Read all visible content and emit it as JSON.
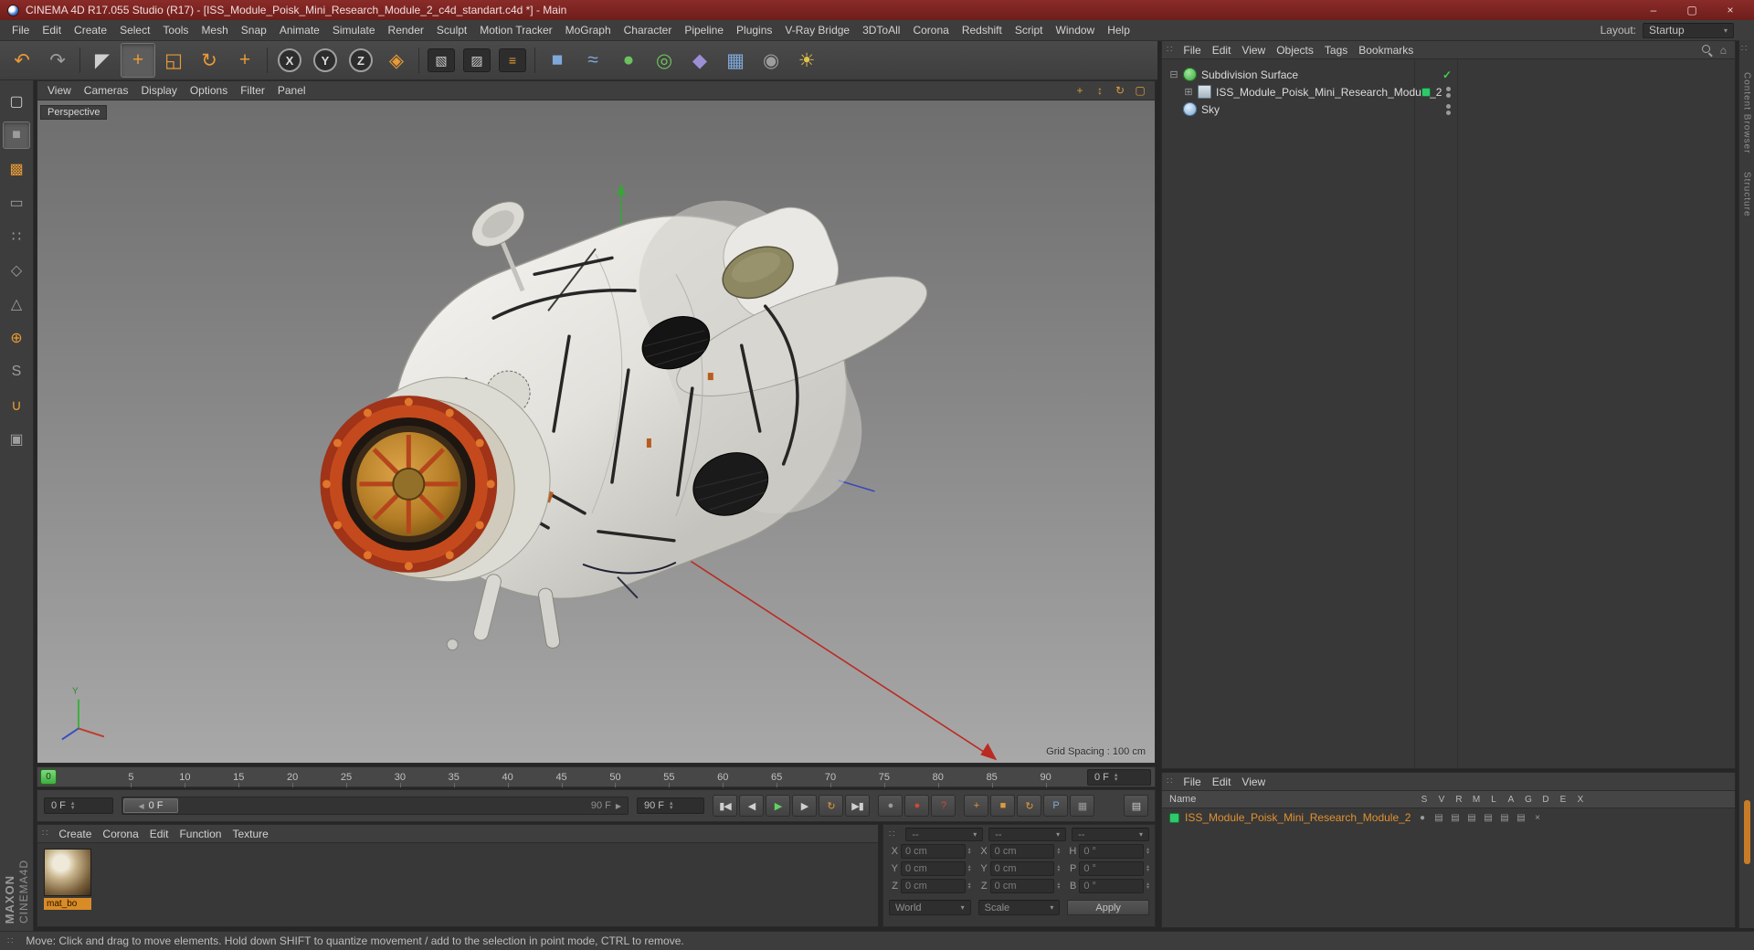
{
  "glyphs": {
    "grip": "∷",
    "caret": "▾",
    "spin_up": "▴",
    "spin_down": "▾",
    "home": "⌂"
  },
  "titlebar": {
    "title": "CINEMA 4D R17.055 Studio (R17) - [ISS_Module_Poisk_Mini_Research_Module_2_c4d_standart.c4d *] - Main",
    "minimize_glyph": "–",
    "maximize_glyph": "▢",
    "close_glyph": "×"
  },
  "menubar": {
    "items": [
      "File",
      "Edit",
      "Create",
      "Select",
      "Tools",
      "Mesh",
      "Snap",
      "Animate",
      "Simulate",
      "Render",
      "Sculpt",
      "Motion Tracker",
      "MoGraph",
      "Character",
      "Pipeline",
      "Plugins",
      "V-Ray Bridge",
      "3DToAll",
      "Corona",
      "Redshift",
      "Script",
      "Window",
      "Help"
    ],
    "layout_label": "Layout:",
    "layout_value": "Startup"
  },
  "toolbar": {
    "tools": [
      {
        "name": "undo-icon",
        "glyph": "↶",
        "color": "orange"
      },
      {
        "name": "redo-icon",
        "glyph": "↷",
        "color": "gray"
      },
      {
        "name": "toolbar-separator",
        "type": "sep",
        "glyph": "",
        "interactable": "false"
      },
      {
        "name": "live-selection-tool",
        "glyph": "◤",
        "color": "light"
      },
      {
        "name": "move-tool",
        "glyph": "+",
        "color": "orange",
        "state": "active"
      },
      {
        "name": "scale-tool",
        "glyph": "◱",
        "color": "orange"
      },
      {
        "name": "rotate-tool",
        "glyph": "↻",
        "color": "orange"
      },
      {
        "name": "last-used-tool",
        "glyph": "+",
        "color": "orange"
      },
      {
        "name": "toolbar-separator",
        "type": "sep",
        "glyph": "",
        "interactable": "false"
      },
      {
        "name": "lock-x-axis-button",
        "glyph": "X",
        "shape": "circle"
      },
      {
        "name": "lock-y-axis-button",
        "glyph": "Y",
        "shape": "circle"
      },
      {
        "name": "lock-z-axis-button",
        "glyph": "Z",
        "shape": "circle"
      },
      {
        "name": "coordinate-system-button",
        "glyph": "◈",
        "color": "orange"
      },
      {
        "name": "toolbar-separator",
        "type": "sep",
        "glyph": "",
        "interactable": "false"
      },
      {
        "name": "render-view-button",
        "glyph": "▧",
        "shape": "tile",
        "color": "light"
      },
      {
        "name": "render-to-picture-viewer-button",
        "glyph": "▨",
        "shape": "tile",
        "color": "light"
      },
      {
        "name": "render-settings-button",
        "glyph": "≡",
        "shape": "tile",
        "color": "orange"
      },
      {
        "name": "toolbar-separator",
        "type": "sep",
        "glyph": "",
        "interactable": "false"
      },
      {
        "name": "add-primitive-button",
        "glyph": "■",
        "color": "blue"
      },
      {
        "name": "add-spline-button",
        "glyph": "≈",
        "color": "blue"
      },
      {
        "name": "add-generator-button",
        "glyph": "●",
        "color": "green"
      },
      {
        "name": "add-mograph-button",
        "glyph": "◎",
        "color": "green"
      },
      {
        "name": "add-deformer-button",
        "glyph": "◆",
        "color": "purple"
      },
      {
        "name": "add-environment-button",
        "glyph": "▦",
        "color": "blue"
      },
      {
        "name": "add-camera-button",
        "glyph": "◉",
        "color": "gray"
      },
      {
        "name": "add-light-button",
        "glyph": "☀",
        "color": "yellow"
      }
    ]
  },
  "left_toolbar": {
    "tools": [
      {
        "name": "make-editable-button",
        "glyph": "▢",
        "color": "light"
      },
      {
        "name": "model-mode-button",
        "glyph": "■",
        "color": "gray",
        "state": "active"
      },
      {
        "name": "texture-mode-button",
        "glyph": "▩",
        "color": "orange"
      },
      {
        "name": "workplane-mode-button",
        "glyph": "▭",
        "color": "gray"
      },
      {
        "name": "points-mode-button",
        "glyph": "∷",
        "color": "gray"
      },
      {
        "name": "edges-mode-button",
        "glyph": "◇",
        "color": "gray"
      },
      {
        "name": "polygons-mode-button",
        "glyph": "△",
        "color": "gray"
      },
      {
        "name": "enable-axis-button",
        "glyph": "⊕",
        "color": "orange"
      },
      {
        "name": "viewport-solo-button",
        "glyph": "S",
        "color": "gray"
      },
      {
        "name": "snap-button",
        "glyph": "∪",
        "color": "orange"
      },
      {
        "name": "lock-workplane-button",
        "glyph": "▣",
        "color": "gray"
      }
    ]
  },
  "viewport": {
    "menu": [
      "View",
      "Cameras",
      "Display",
      "Options",
      "Filter",
      "Panel"
    ],
    "nav_icons": [
      {
        "name": "pan-view-icon",
        "glyph": "+"
      },
      {
        "name": "dolly-view-icon",
        "glyph": "↕"
      },
      {
        "name": "rotate-view-icon",
        "glyph": "↻"
      },
      {
        "name": "toggle-active-view-icon",
        "glyph": "▢"
      }
    ],
    "camera_label": "Perspective",
    "grid_spacing": "Grid Spacing : 100 cm",
    "axis_y_label": "Y"
  },
  "timeline": {
    "marker": "0",
    "ticks": [
      "5",
      "10",
      "15",
      "20",
      "25",
      "30",
      "35",
      "40",
      "45",
      "50",
      "55",
      "60",
      "65",
      "70",
      "75",
      "80",
      "85",
      "90"
    ],
    "frame_spinner": "0 F"
  },
  "playbar": {
    "start_field": "0 F",
    "slider_handle": "0 F",
    "slider_end": "90 F",
    "end_field": "90 F",
    "handle_grip": "◀",
    "end_grip": "▶",
    "transport": [
      {
        "name": "go-to-start-button",
        "glyph": "▮◀"
      },
      {
        "name": "previous-frame-button",
        "glyph": "◀"
      },
      {
        "name": "play-button",
        "glyph": "▶",
        "color": "green"
      },
      {
        "name": "next-frame-button",
        "glyph": "▶"
      },
      {
        "name": "loop-mode-button",
        "glyph": "↻",
        "color": "orange"
      },
      {
        "name": "go-to-end-button",
        "glyph": "▶▮"
      }
    ],
    "record": [
      {
        "name": "record-scene-button",
        "glyph": "●",
        "color": "gray"
      },
      {
        "name": "record-keyframe-button",
        "glyph": "●",
        "color": "red"
      },
      {
        "name": "autokey-button",
        "glyph": "?",
        "color": "red"
      }
    ],
    "keyframe": [
      {
        "name": "key-position-button",
        "glyph": "+",
        "color": "orange"
      },
      {
        "name": "key-scale-button",
        "glyph": "■",
        "color": "orange"
      },
      {
        "name": "key-rotation-button",
        "glyph": "↻",
        "color": "orange"
      },
      {
        "name": "key-parameter-button",
        "glyph": "P",
        "color": "blue"
      },
      {
        "name": "key-selection-button",
        "glyph": "▦",
        "color": "gray"
      }
    ],
    "options_glyph": "▤"
  },
  "materials": {
    "menu": [
      "Create",
      "Corona",
      "Edit",
      "Function",
      "Texture"
    ],
    "material_name": "mat_bo"
  },
  "coordinates": {
    "headers": [
      "--",
      "--",
      "--"
    ],
    "rows": [
      {
        "l1": "X",
        "v1": "0 cm",
        "l2": "X",
        "v2": "0 cm",
        "l3": "H",
        "v3": "0 °"
      },
      {
        "l1": "Y",
        "v1": "0 cm",
        "l2": "Y",
        "v2": "0 cm",
        "l3": "P",
        "v3": "0 °"
      },
      {
        "l1": "Z",
        "v1": "0 cm",
        "l2": "Z",
        "v2": "0 cm",
        "l3": "B",
        "v3": "0 °"
      }
    ],
    "space_value": "World",
    "scale_value": "Scale",
    "apply_label": "Apply"
  },
  "object_manager": {
    "menu": [
      "File",
      "Edit",
      "View",
      "Objects",
      "Tags",
      "Bookmarks"
    ],
    "objects": [
      {
        "name": "Subdivision Surface",
        "icon": "subdivision-surface",
        "depth": "0",
        "expander": "⊟",
        "chip_style": "visibility:hidden",
        "col2": "check",
        "check": "✓"
      },
      {
        "name": "ISS_Module_Poisk_Mini_Research_Module_2",
        "icon": "polygon-object",
        "depth": "1",
        "expander": "⊞",
        "chip_style": "background:#2ec96a",
        "col2": "dots",
        "check": ""
      },
      {
        "name": "Sky",
        "icon": "sky-object",
        "depth": "0",
        "expander": "",
        "chip_style": "visibility:hidden",
        "col2": "dots",
        "check": ""
      }
    ]
  },
  "layer_panel": {
    "menu": [
      "File",
      "Edit",
      "View"
    ],
    "name_header": "Name",
    "columns": [
      "S",
      "V",
      "R",
      "M",
      "L",
      "A",
      "G",
      "D",
      "E",
      "X"
    ],
    "item": {
      "name": "ISS_Module_Poisk_Mini_Research_Module_2",
      "toggles": [
        {
          "name": "layer-solo-toggle",
          "glyph": "●"
        },
        {
          "name": "layer-visible-toggle",
          "glyph": "▤"
        },
        {
          "name": "layer-render-toggle",
          "glyph": "▤"
        },
        {
          "name": "layer-manager-toggle",
          "glyph": "▤"
        },
        {
          "name": "layer-lock-toggle",
          "glyph": "▤"
        },
        {
          "name": "layer-animation-toggle",
          "glyph": "▤"
        },
        {
          "name": "layer-generators-toggle",
          "glyph": "▤"
        },
        {
          "name": "layer-xref-toggle",
          "glyph": "×"
        }
      ]
    }
  },
  "right_dock": {
    "tabs": [
      "Content Browser",
      "Structure"
    ]
  },
  "statusbar": {
    "message": "Move: Click and drag to move elements. Hold down SHIFT to quantize movement / add to the selection in point mode, CTRL to remove."
  },
  "brand": {
    "line1": "MAXON",
    "line2": "CINEMA4D"
  },
  "colors": {
    "accent_orange": "#e8962e",
    "selection_green": "#2ec96a",
    "titlebar_red": "#7b2423",
    "viewport_top": "#6e6e6e",
    "viewport_bottom": "#a8a8a8"
  }
}
